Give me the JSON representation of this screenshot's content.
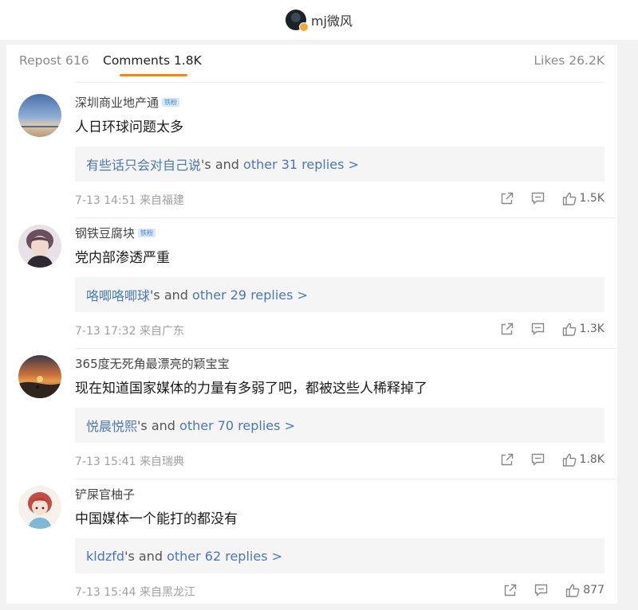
{
  "header": {
    "username": "mj微风",
    "avatar_icon": "user-avatar-icon",
    "verified_icon": "verified-badge-icon"
  },
  "tabs": {
    "repost": "Repost 616",
    "comments": "Comments 1.8K",
    "likes": "Likes 26.2K"
  },
  "accent_color": "#ff8200",
  "link_color": "#4a78b4",
  "comments": [
    {
      "name": "深圳商业地产通",
      "badge": "铁粉",
      "text": "人日环球问题太多",
      "reply_user": "有些话只会对自己说",
      "reply_mid": "'s and ",
      "reply_more": "other 31 replies >",
      "time": "7-13 14:51",
      "location": "来自福建",
      "likes": "1.5K"
    },
    {
      "name": "钢铁豆腐块",
      "badge": "铁粉",
      "text": "党内部渗透严重",
      "reply_user": "咯唧咯唧球",
      "reply_mid": "'s and ",
      "reply_more": "other 29 replies >",
      "time": "7-13 17:32",
      "location": "来自广东",
      "likes": "1.3K"
    },
    {
      "name": "365度无死角最漂亮的颖宝宝",
      "badge": "",
      "text": "现在知道国家媒体的力量有多弱了吧，都被这些人稀释掉了",
      "reply_user": "悦晨悦熙",
      "reply_mid": "'s and ",
      "reply_more": "other 70 replies >",
      "time": "7-13 15:41",
      "location": "来自瑞典",
      "likes": "1.8K"
    },
    {
      "name": "铲屎官柚子",
      "badge": "",
      "text": "中国媒体一个能打的都没有",
      "reply_user": "kldzfd",
      "reply_mid": "'s and ",
      "reply_more": "other 62 replies >",
      "time": "7-13 15:44",
      "location": "来自黑龙江",
      "likes": "877"
    }
  ]
}
